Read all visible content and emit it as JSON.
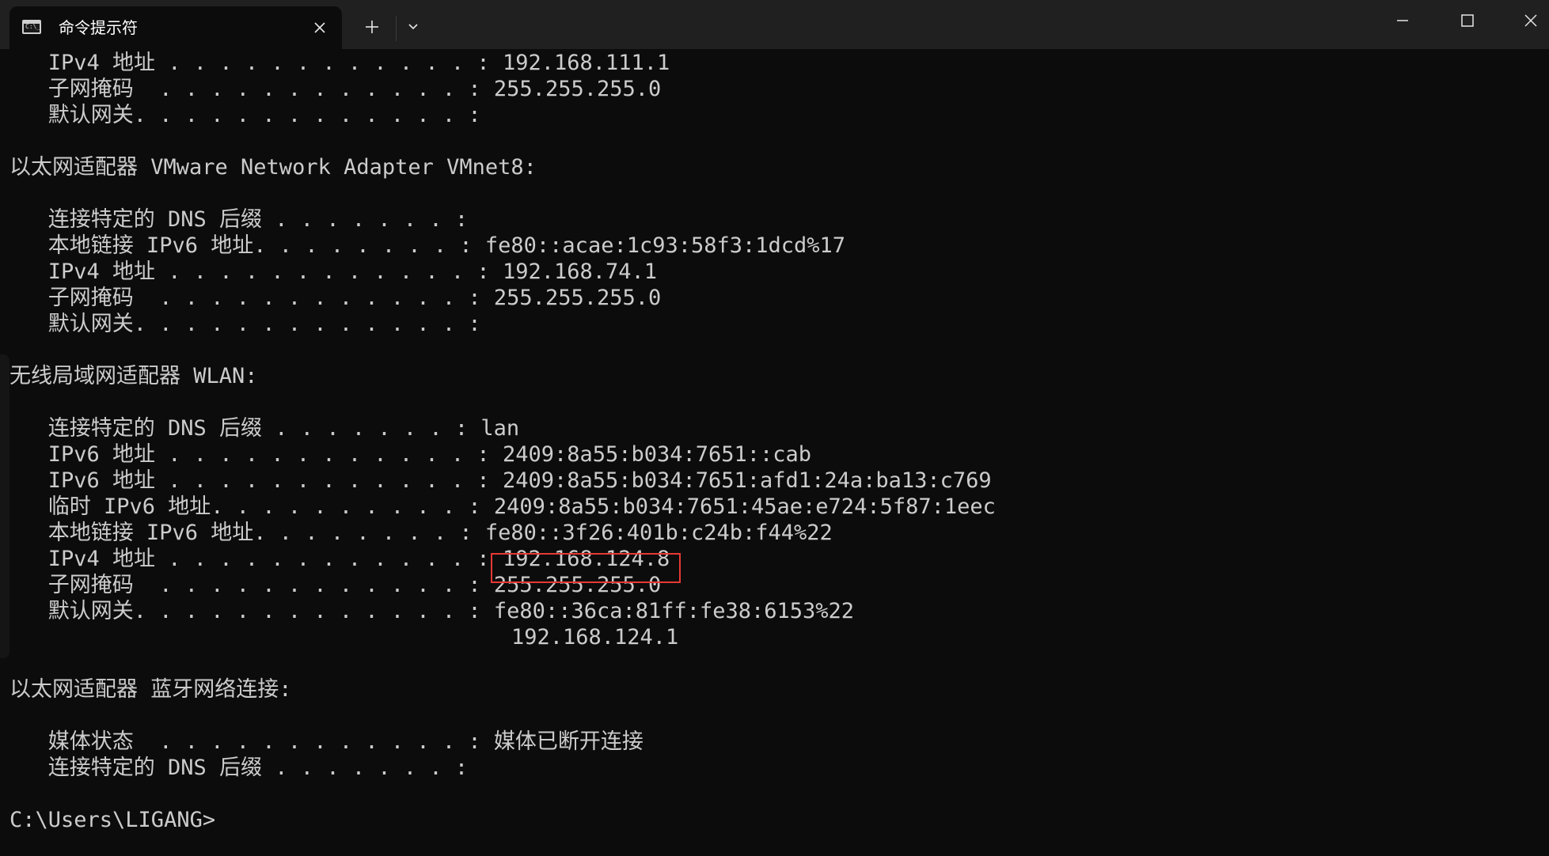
{
  "window": {
    "tab_title": "命令提示符",
    "tab_icon": "cmd-icon",
    "new_tab_icon": "plus-icon",
    "dropdown_icon": "chevron-down-icon",
    "minimize_icon": "minimize-icon",
    "maximize_icon": "maximize-icon",
    "close_icon": "close-icon"
  },
  "terminal": {
    "lines": [
      "   IPv4 地址 . . . . . . . . . . . . : 192.168.111.1",
      "   子网掩码  . . . . . . . . . . . . : 255.255.255.0",
      "   默认网关. . . . . . . . . . . . . :",
      "",
      "以太网适配器 VMware Network Adapter VMnet8:",
      "",
      "   连接特定的 DNS 后缀 . . . . . . . :",
      "   本地链接 IPv6 地址. . . . . . . . : fe80::acae:1c93:58f3:1dcd%17",
      "   IPv4 地址 . . . . . . . . . . . . : 192.168.74.1",
      "   子网掩码  . . . . . . . . . . . . : 255.255.255.0",
      "   默认网关. . . . . . . . . . . . . :",
      "",
      "无线局域网适配器 WLAN:",
      "",
      "   连接特定的 DNS 后缀 . . . . . . . : lan",
      "   IPv6 地址 . . . . . . . . . . . . : 2409:8a55:b034:7651::cab",
      "   IPv6 地址 . . . . . . . . . . . . : 2409:8a55:b034:7651:afd1:24a:ba13:c769",
      "   临时 IPv6 地址. . . . . . . . . . : 2409:8a55:b034:7651:45ae:e724:5f87:1eec",
      "   本地链接 IPv6 地址. . . . . . . . : fe80::3f26:401b:c24b:f44%22",
      "   IPv4 地址 . . . . . . . . . . . . : 192.168.124.8",
      "   子网掩码  . . . . . . . . . . . . : 255.255.255.0",
      "   默认网关. . . . . . . . . . . . . : fe80::36ca:81ff:fe38:6153%22",
      "                                       192.168.124.1",
      "",
      "以太网适配器 蓝牙网络连接:",
      "",
      "   媒体状态  . . . . . . . . . . . . : 媒体已断开连接",
      "   连接特定的 DNS 后缀 . . . . . . . :",
      "",
      "C:\\Users\\LIGANG>"
    ],
    "highlighted_value": "192.168.124.8",
    "highlight_color": "#e53935",
    "text_color": "#cccccc",
    "background_color": "#0c0c0c"
  }
}
